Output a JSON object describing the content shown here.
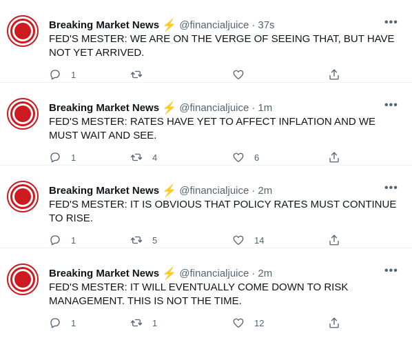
{
  "author": {
    "name": "Breaking Market News",
    "badge_icon": "lightning-bolt-icon",
    "badge_glyph": "⚡",
    "handle": "@financialjuice",
    "avatar_color": "#cc1a20"
  },
  "separator": "·",
  "more_glyph": "•••",
  "tweets": [
    {
      "time": "37s",
      "text": "FED'S MESTER: WE ARE ON THE VERGE OF SEEING THAT, BUT HAVE NOT YET ARRIVED.",
      "replies": "1",
      "retweets": "",
      "likes": ""
    },
    {
      "time": "1m",
      "text": "FED'S MESTER: RATES HAVE YET TO AFFECT INFLATION AND WE MUST WAIT AND SEE.",
      "replies": "1",
      "retweets": "4",
      "likes": "6"
    },
    {
      "time": "2m",
      "text": "FED'S MESTER: IT IS OBVIOUS THAT POLICY RATES MUST CONTINUE TO RISE.",
      "replies": "1",
      "retweets": "5",
      "likes": "14"
    },
    {
      "time": "2m",
      "text": "FED'S MESTER: IT WILL EVENTUALLY COME DOWN TO RISK MANAGEMENT. THIS IS NOT THE TIME.",
      "replies": "1",
      "retweets": "1",
      "likes": "12"
    }
  ],
  "icons": {
    "reply": "reply-icon",
    "retweet": "retweet-icon",
    "like": "like-icon",
    "share": "share-icon",
    "more": "more-icon"
  },
  "colors": {
    "text": "#0f1419",
    "secondary": "#536471",
    "divider": "#eff3f4",
    "bolt": "#f7b500"
  }
}
